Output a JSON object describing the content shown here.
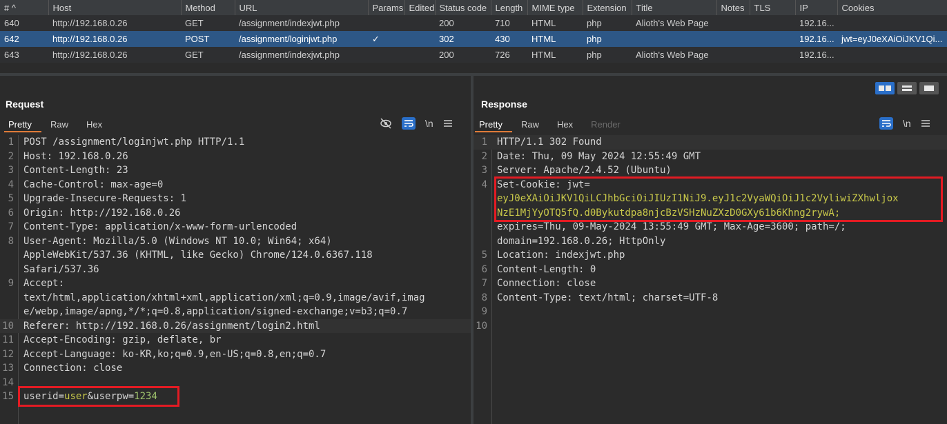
{
  "history": {
    "columns": [
      "# ^",
      "Host",
      "Method",
      "URL",
      "Params",
      "Edited",
      "Status code",
      "Length",
      "MIME type",
      "Extension",
      "Title",
      "Notes",
      "TLS",
      "IP",
      "Cookies"
    ],
    "rows": [
      {
        "num": "640",
        "host": "http://192.168.0.26",
        "method": "GET",
        "url": "/assignment/indexjwt.php",
        "params": "",
        "edited": "",
        "status": "200",
        "length": "710",
        "mime": "HTML",
        "ext": "php",
        "title": "Alioth's Web Page",
        "notes": "",
        "tls": "",
        "ip": "192.16...",
        "cookies": ""
      },
      {
        "num": "642",
        "host": "http://192.168.0.26",
        "method": "POST",
        "url": "/assignment/loginjwt.php",
        "params": "✓",
        "edited": "",
        "status": "302",
        "length": "430",
        "mime": "HTML",
        "ext": "php",
        "title": "",
        "notes": "",
        "tls": "",
        "ip": "192.16...",
        "cookies": "jwt=eyJ0eXAiOiJKV1Qi..."
      },
      {
        "num": "643",
        "host": "http://192.168.0.26",
        "method": "GET",
        "url": "/assignment/indexjwt.php",
        "params": "",
        "edited": "",
        "status": "200",
        "length": "726",
        "mime": "HTML",
        "ext": "php",
        "title": "Alioth's Web Page",
        "notes": "",
        "tls": "",
        "ip": "192.16...",
        "cookies": ""
      }
    ],
    "selected_row": 1
  },
  "request": {
    "title": "Request",
    "tabs": [
      "Pretty",
      "Raw",
      "Hex"
    ],
    "newline_label": "\\n",
    "lines": [
      {
        "n": "1",
        "t": "POST /assignment/loginjwt.php HTTP/1.1"
      },
      {
        "n": "2",
        "t": "Host: 192.168.0.26"
      },
      {
        "n": "3",
        "t": "Content-Length: 23"
      },
      {
        "n": "4",
        "t": "Cache-Control: max-age=0"
      },
      {
        "n": "5",
        "t": "Upgrade-Insecure-Requests: 1"
      },
      {
        "n": "6",
        "t": "Origin: http://192.168.0.26"
      },
      {
        "n": "7",
        "t": "Content-Type: application/x-www-form-urlencoded"
      },
      {
        "n": "8",
        "t": "User-Agent: Mozilla/5.0 (Windows NT 10.0; Win64; x64)"
      },
      {
        "n": "",
        "t": "AppleWebKit/537.36 (KHTML, like Gecko) Chrome/124.0.6367.118"
      },
      {
        "n": "",
        "t": "Safari/537.36"
      },
      {
        "n": "9",
        "t": "Accept:"
      },
      {
        "n": "",
        "t": "text/html,application/xhtml+xml,application/xml;q=0.9,image/avif,imag"
      },
      {
        "n": "",
        "t": "e/webp,image/apng,*/*;q=0.8,application/signed-exchange;v=b3;q=0.7"
      },
      {
        "n": "10",
        "t": "Referer: http://192.168.0.26/assignment/login2.html"
      },
      {
        "n": "11",
        "t": "Accept-Encoding: gzip, deflate, br"
      },
      {
        "n": "12",
        "t": "Accept-Language: ko-KR,ko;q=0.9,en-US;q=0.8,en;q=0.7"
      },
      {
        "n": "13",
        "t": "Connection: close"
      },
      {
        "n": "14",
        "t": ""
      }
    ],
    "body": {
      "n": "15",
      "k1": "userid",
      "v1": "user",
      "sep": "&",
      "k2": "userpw",
      "v2": "1234"
    }
  },
  "response": {
    "title": "Response",
    "tabs": [
      "Pretty",
      "Raw",
      "Hex",
      "Render"
    ],
    "newline_label": "\\n",
    "lines": [
      {
        "n": "1",
        "t": "HTTP/1.1 302 Found"
      },
      {
        "n": "2",
        "t": "Date: Thu, 09 May 2024 12:55:49 GMT"
      },
      {
        "n": "3",
        "t": "Server: Apache/2.4.52 (Ubuntu)"
      },
      {
        "n": "4",
        "t": "Set-Cookie: jwt="
      },
      {
        "n": "",
        "t": "eyJ0eXAiOiJKV1QiLCJhbGciOiJIUzI1NiJ9.eyJ1c2VyaWQiOiJ1c2VyliwiZXhwljox",
        "jwt": true
      },
      {
        "n": "",
        "t": "NzE1MjYyOTQ5fQ.d0Bykutdpa8njcBzVSHzNuZXzD0GXy61b6Khng2rywA;",
        "jwt": true
      },
      {
        "n": "",
        "t": "expires=Thu, 09-May-2024 13:55:49 GMT; Max-Age=3600; path=/;"
      },
      {
        "n": "",
        "t": "domain=192.168.0.26; HttpOnly"
      },
      {
        "n": "5",
        "t": "Location: indexjwt.php"
      },
      {
        "n": "6",
        "t": "Content-Length: 0"
      },
      {
        "n": "7",
        "t": "Connection: close"
      },
      {
        "n": "8",
        "t": "Content-Type: text/html; charset=UTF-8"
      },
      {
        "n": "9",
        "t": ""
      },
      {
        "n": "10",
        "t": ""
      }
    ]
  },
  "colors": {
    "selected_row": "#2d5786",
    "accent_tab": "#e07b39",
    "highlight_box": "#e31b23",
    "tool_blue": "#2a6fc9"
  }
}
